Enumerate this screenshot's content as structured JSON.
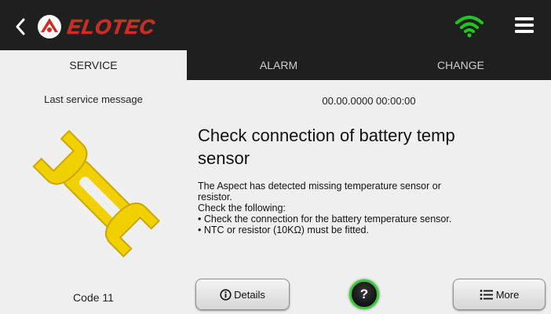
{
  "header": {
    "brand": "ELOTEC",
    "icons": {
      "back": "chevron-left-icon",
      "logo": "elotec-logo-icon",
      "wifi": "wifi-icon",
      "menu": "hamburger-menu-icon"
    },
    "colors": {
      "brand": "#d42a1e",
      "wifi": "#22c522"
    }
  },
  "tabs": [
    {
      "label": "SERVICE",
      "active": true
    },
    {
      "label": "ALARM",
      "active": false
    },
    {
      "label": "CHANGE",
      "active": false
    }
  ],
  "left": {
    "last_service_label": "Last service message",
    "code_label": "Code 11",
    "icon": "wrench-icon"
  },
  "message": {
    "timestamp": "00.00.0000 00:00:00",
    "title_line1": "Check connection of battery temp",
    "title_line2": "sensor",
    "body": [
      "The Aspect has detected missing temperature sensor or",
      "resistor.",
      "Check the following:",
      "• Check the connection for the battery temperature sensor.",
      "• NTC or resistor (10KΩ) must be fitted."
    ]
  },
  "buttons": {
    "details_label": "Details",
    "help_label": "?",
    "more_label": "More"
  }
}
